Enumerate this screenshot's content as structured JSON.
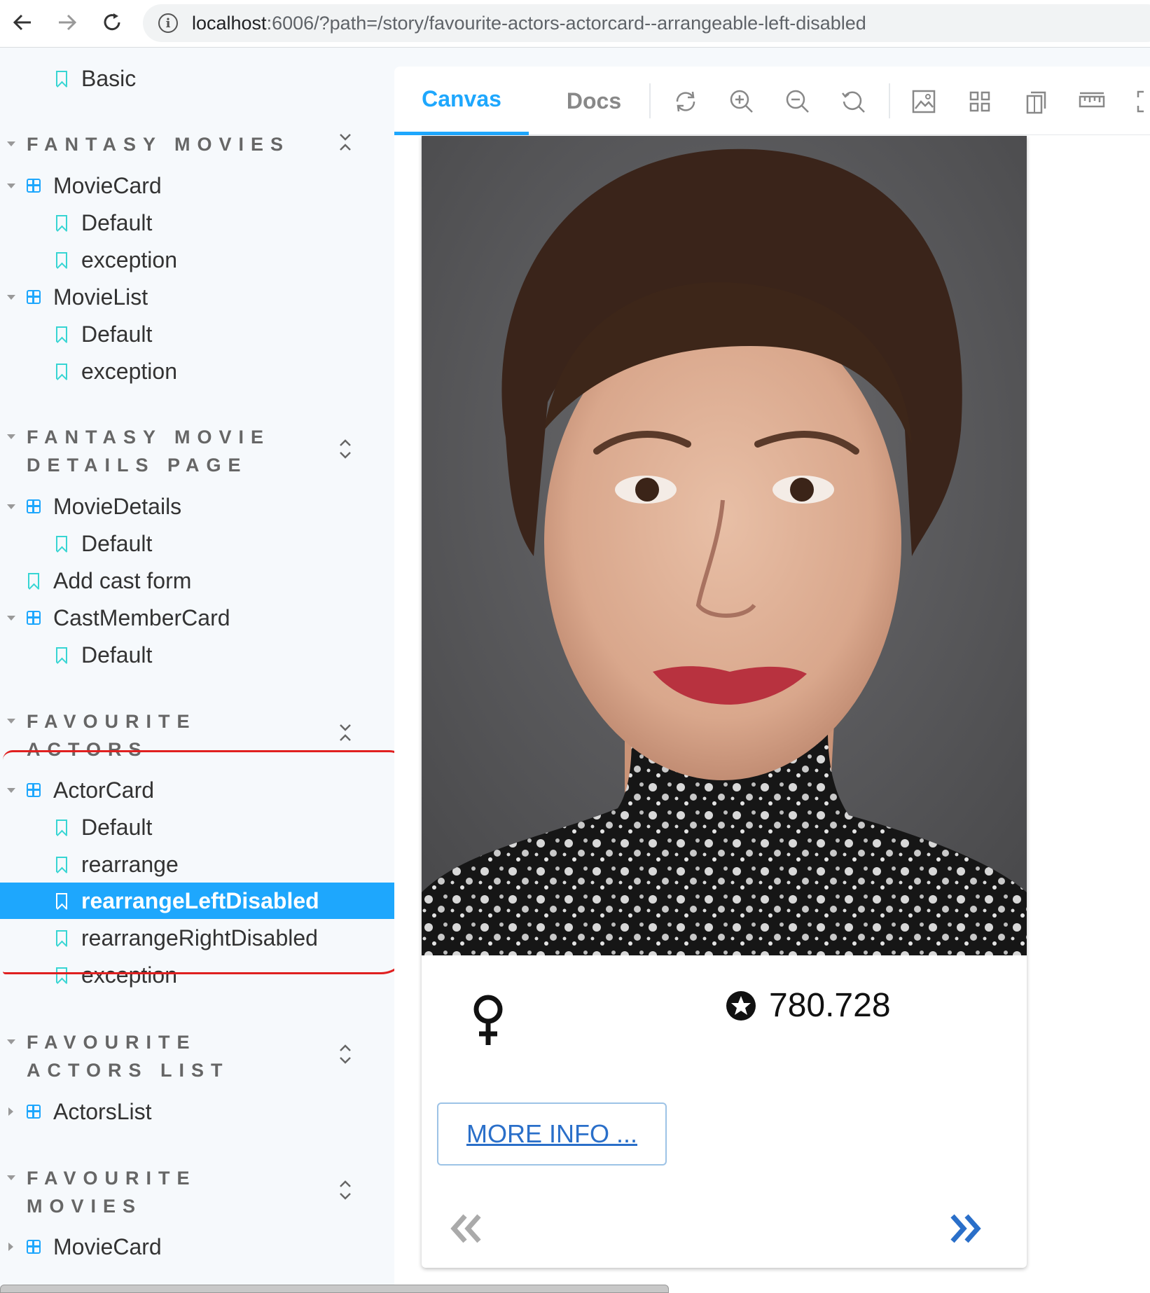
{
  "browser": {
    "url_host": "localhost",
    "url_path": ":6006/?path=/story/favourite-actors-actorcard--arrangeable-left-disabled"
  },
  "sidebar": {
    "top_item": "Basic",
    "groups": [
      {
        "title": "FANTASY MOVIES",
        "items": [
          "MovieCard",
          "Default",
          "exception",
          "MovieList",
          "Default",
          "exception"
        ]
      },
      {
        "title_line1": "FANTASY MOVIE",
        "title_line2": "DETAILS PAGE",
        "items": [
          "MovieDetails",
          "Default",
          "Add cast form",
          "CastMemberCard",
          "Default"
        ]
      },
      {
        "title_line1": "FAVOURITE",
        "title_line2": "ACTORS",
        "items": [
          "ActorCard",
          "Default",
          "rearrange",
          "rearrangeLeftDisabled",
          "rearrangeRightDisabled",
          "exception"
        ]
      },
      {
        "title_line1": "FAVOURITE",
        "title_line2": "ACTORS LIST",
        "items": [
          "ActorsList"
        ]
      },
      {
        "title_line1": "FAVOURITE",
        "title_line2": "MOVIES",
        "items": [
          "MovieCard"
        ]
      }
    ]
  },
  "toolbar": {
    "tab_canvas": "Canvas",
    "tab_docs": "Docs",
    "icons": [
      "refresh-icon",
      "zoom-in-icon",
      "zoom-out-icon",
      "zoom-reset-icon",
      "background-icon",
      "grid-icon",
      "viewport-icon",
      "measure-icon",
      "fullscreen-icon"
    ]
  },
  "card": {
    "rating": "780.728",
    "more_info": "MORE INFO ...",
    "gender_icon": "female-icon",
    "rating_icon": "star-circle-icon"
  },
  "colors": {
    "accent": "#1ea7fd",
    "story": "#37d5d3",
    "highlight": "#e02020"
  }
}
